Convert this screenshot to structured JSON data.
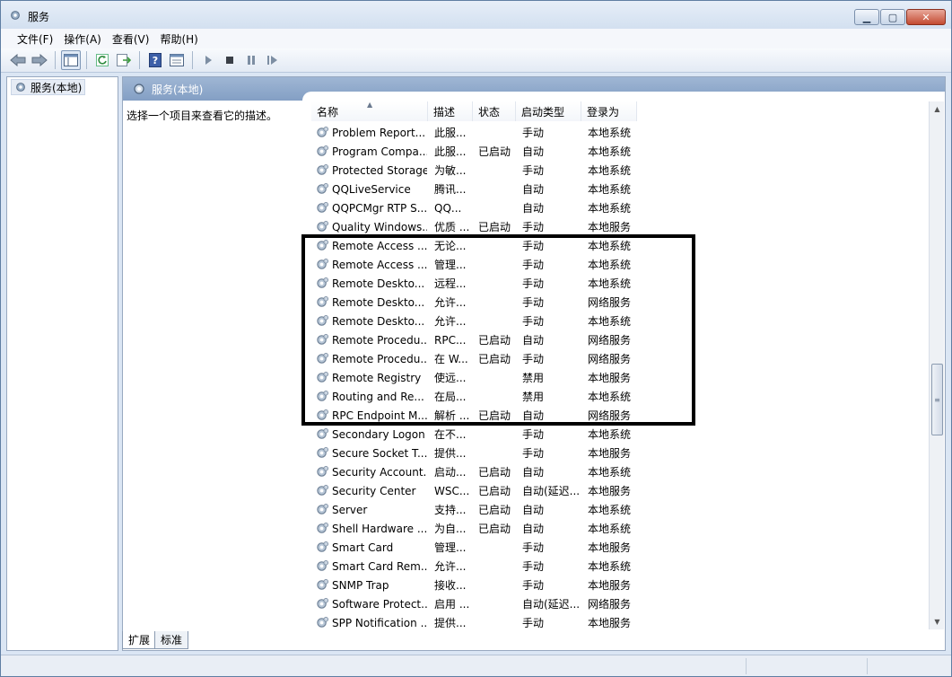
{
  "window": {
    "title": "服务"
  },
  "menu": [
    "文件(F)",
    "操作(A)",
    "查看(V)",
    "帮助(H)"
  ],
  "toolbar_icons": [
    "back-arrow-icon",
    "forward-arrow-icon",
    "show-hide-console-tree-icon",
    "refresh-icon",
    "export-list-icon",
    "help-icon",
    "properties-icon",
    "start-service-icon",
    "stop-service-icon",
    "pause-service-icon",
    "restart-service-icon"
  ],
  "tree": {
    "item": "服务(本地)"
  },
  "pane": {
    "header": "服务(本地)",
    "description": "选择一个项目来查看它的描述。"
  },
  "columns": [
    "名称",
    "描述",
    "状态",
    "启动类型",
    "登录为"
  ],
  "services": [
    {
      "name": "Problem Report...",
      "desc": "此服...",
      "status": "",
      "startup": "手动",
      "logon": "本地系统"
    },
    {
      "name": "Program Compa...",
      "desc": "此服...",
      "status": "已启动",
      "startup": "自动",
      "logon": "本地系统"
    },
    {
      "name": "Protected Storage",
      "desc": "为敏...",
      "status": "",
      "startup": "手动",
      "logon": "本地系统"
    },
    {
      "name": "QQLiveService",
      "desc": "腾讯...",
      "status": "",
      "startup": "自动",
      "logon": "本地系统"
    },
    {
      "name": "QQPCMgr RTP S...",
      "desc": "QQ...",
      "status": "",
      "startup": "自动",
      "logon": "本地系统"
    },
    {
      "name": "Quality Windows...",
      "desc": "优质 ...",
      "status": "已启动",
      "startup": "手动",
      "logon": "本地服务"
    },
    {
      "name": "Remote Access ...",
      "desc": "无论...",
      "status": "",
      "startup": "手动",
      "logon": "本地系统"
    },
    {
      "name": "Remote Access ...",
      "desc": "管理...",
      "status": "",
      "startup": "手动",
      "logon": "本地系统"
    },
    {
      "name": "Remote Deskto...",
      "desc": "远程...",
      "status": "",
      "startup": "手动",
      "logon": "本地系统"
    },
    {
      "name": "Remote Deskto...",
      "desc": "允许...",
      "status": "",
      "startup": "手动",
      "logon": "网络服务"
    },
    {
      "name": "Remote Deskto...",
      "desc": "允许...",
      "status": "",
      "startup": "手动",
      "logon": "本地系统"
    },
    {
      "name": "Remote Procedu...",
      "desc": "RPC...",
      "status": "已启动",
      "startup": "自动",
      "logon": "网络服务"
    },
    {
      "name": "Remote Procedu...",
      "desc": "在 W...",
      "status": "已启动",
      "startup": "手动",
      "logon": "网络服务"
    },
    {
      "name": "Remote Registry",
      "desc": "使远...",
      "status": "",
      "startup": "禁用",
      "logon": "本地服务"
    },
    {
      "name": "Routing and Re...",
      "desc": "在局...",
      "status": "",
      "startup": "禁用",
      "logon": "本地系统"
    },
    {
      "name": "RPC Endpoint M...",
      "desc": "解析 ...",
      "status": "已启动",
      "startup": "自动",
      "logon": "网络服务"
    },
    {
      "name": "Secondary Logon",
      "desc": "在不...",
      "status": "",
      "startup": "手动",
      "logon": "本地系统"
    },
    {
      "name": "Secure Socket T...",
      "desc": "提供...",
      "status": "",
      "startup": "手动",
      "logon": "本地服务"
    },
    {
      "name": "Security Account...",
      "desc": "启动...",
      "status": "已启动",
      "startup": "自动",
      "logon": "本地系统"
    },
    {
      "name": "Security Center",
      "desc": "WSC...",
      "status": "已启动",
      "startup": "自动(延迟...",
      "logon": "本地服务"
    },
    {
      "name": "Server",
      "desc": "支持...",
      "status": "已启动",
      "startup": "自动",
      "logon": "本地系统"
    },
    {
      "name": "Shell Hardware ...",
      "desc": "为自...",
      "status": "已启动",
      "startup": "自动",
      "logon": "本地系统"
    },
    {
      "name": "Smart Card",
      "desc": "管理...",
      "status": "",
      "startup": "手动",
      "logon": "本地服务"
    },
    {
      "name": "Smart Card Rem...",
      "desc": "允许...",
      "status": "",
      "startup": "手动",
      "logon": "本地系统"
    },
    {
      "name": "SNMP Trap",
      "desc": "接收...",
      "status": "",
      "startup": "手动",
      "logon": "本地服务"
    },
    {
      "name": "Software Protect...",
      "desc": "启用 ...",
      "status": "",
      "startup": "自动(延迟...",
      "logon": "网络服务"
    },
    {
      "name": "SPP Notification ...",
      "desc": "提供...",
      "status": "",
      "startup": "手动",
      "logon": "本地服务"
    }
  ],
  "tabs": [
    "扩展",
    "标准"
  ]
}
